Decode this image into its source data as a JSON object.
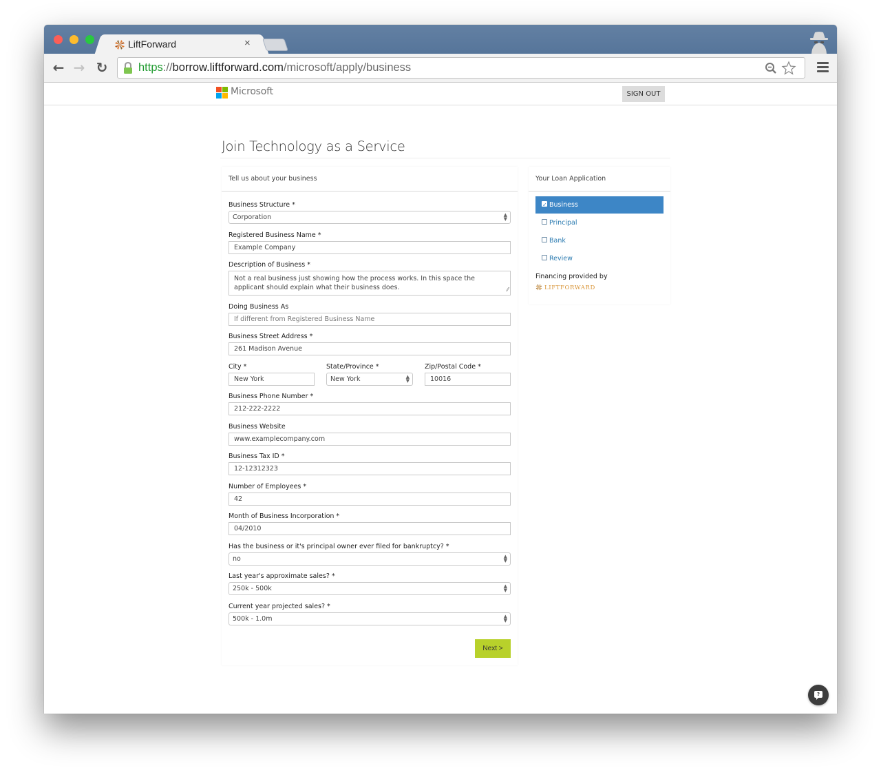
{
  "browser": {
    "tab_title": "LiftForward",
    "tab_close": "×",
    "url_scheme": "https",
    "url_sep": "://",
    "url_host": "borrow.liftforward.com",
    "url_path": "/microsoft/apply/business",
    "icons": {
      "back": "←",
      "forward": "→",
      "reload": "↻"
    }
  },
  "header": {
    "brand": "Microsoft",
    "brand_colors": [
      "#f25022",
      "#7fba00",
      "#00a4ef",
      "#ffb900"
    ],
    "sign_out_label": "SIGN OUT"
  },
  "page": {
    "title": "Join Technology as a Service"
  },
  "form": {
    "heading": "Tell us about your business",
    "fields": {
      "business_structure": {
        "label": "Business Structure *",
        "value": "Corporation"
      },
      "registered_name": {
        "label": "Registered Business Name *",
        "value": "Example Company"
      },
      "description": {
        "label": "Description of Business *",
        "value": "Not a real business just showing how the process works. In this space the applicant should explain what their business does."
      },
      "dba": {
        "label": "Doing Business As",
        "placeholder": "If different from Registered Business Name"
      },
      "street": {
        "label": "Business Street Address *",
        "value": "261 Madison Avenue"
      },
      "city": {
        "label": "City *",
        "value": "New York"
      },
      "state": {
        "label": "State/Province *",
        "value": "New York"
      },
      "zip": {
        "label": "Zip/Postal Code *",
        "value": "10016"
      },
      "phone": {
        "label": "Business Phone Number *",
        "value": "212-222-2222"
      },
      "website": {
        "label": "Business Website",
        "value": "www.examplecompany.com"
      },
      "tax_id": {
        "label": "Business Tax ID *",
        "value": "12-12312323"
      },
      "employees": {
        "label": "Number of Employees *",
        "value": "42"
      },
      "incorporation": {
        "label": "Month of Business Incorporation *",
        "value": "04/2010"
      },
      "bankruptcy": {
        "label": "Has the business or it's principal owner ever filed for bankruptcy? *",
        "value": "no"
      },
      "last_sales": {
        "label": "Last year's approximate sales? *",
        "value": "250k - 500k"
      },
      "projected_sales": {
        "label": "Current year projected sales? *",
        "value": "500k - 1.0m"
      }
    },
    "next_label": "Next >",
    "next_color": "#b8d12b"
  },
  "sidebar": {
    "heading": "Your Loan Application",
    "steps": [
      {
        "label": "Business",
        "checked": true,
        "active": true
      },
      {
        "label": "Principal",
        "checked": false,
        "active": false
      },
      {
        "label": "Bank",
        "checked": false,
        "active": false
      },
      {
        "label": "Review",
        "checked": false,
        "active": false
      }
    ],
    "active_color": "#3d86c6",
    "financing_text": "Financing provided by",
    "financier": "LiftForward"
  },
  "help": {
    "icon_glyph": "?"
  }
}
